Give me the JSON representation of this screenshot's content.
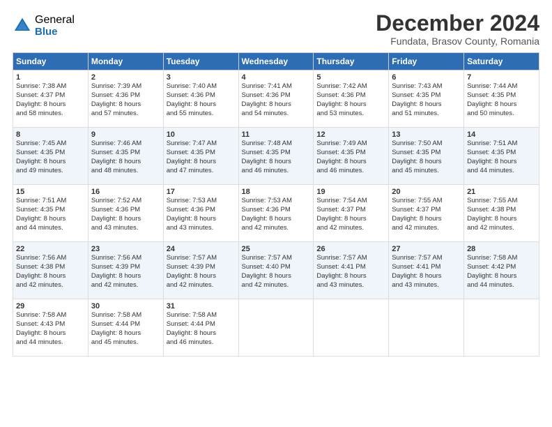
{
  "header": {
    "logo_general": "General",
    "logo_blue": "Blue",
    "title": "December 2024",
    "subtitle": "Fundata, Brasov County, Romania"
  },
  "columns": [
    "Sunday",
    "Monday",
    "Tuesday",
    "Wednesday",
    "Thursday",
    "Friday",
    "Saturday"
  ],
  "weeks": [
    [
      {
        "day": "1",
        "lines": [
          "Sunrise: 7:38 AM",
          "Sunset: 4:37 PM",
          "Daylight: 8 hours",
          "and 58 minutes."
        ]
      },
      {
        "day": "2",
        "lines": [
          "Sunrise: 7:39 AM",
          "Sunset: 4:36 PM",
          "Daylight: 8 hours",
          "and 57 minutes."
        ]
      },
      {
        "day": "3",
        "lines": [
          "Sunrise: 7:40 AM",
          "Sunset: 4:36 PM",
          "Daylight: 8 hours",
          "and 55 minutes."
        ]
      },
      {
        "day": "4",
        "lines": [
          "Sunrise: 7:41 AM",
          "Sunset: 4:36 PM",
          "Daylight: 8 hours",
          "and 54 minutes."
        ]
      },
      {
        "day": "5",
        "lines": [
          "Sunrise: 7:42 AM",
          "Sunset: 4:36 PM",
          "Daylight: 8 hours",
          "and 53 minutes."
        ]
      },
      {
        "day": "6",
        "lines": [
          "Sunrise: 7:43 AM",
          "Sunset: 4:35 PM",
          "Daylight: 8 hours",
          "and 51 minutes."
        ]
      },
      {
        "day": "7",
        "lines": [
          "Sunrise: 7:44 AM",
          "Sunset: 4:35 PM",
          "Daylight: 8 hours",
          "and 50 minutes."
        ]
      }
    ],
    [
      {
        "day": "8",
        "lines": [
          "Sunrise: 7:45 AM",
          "Sunset: 4:35 PM",
          "Daylight: 8 hours",
          "and 49 minutes."
        ]
      },
      {
        "day": "9",
        "lines": [
          "Sunrise: 7:46 AM",
          "Sunset: 4:35 PM",
          "Daylight: 8 hours",
          "and 48 minutes."
        ]
      },
      {
        "day": "10",
        "lines": [
          "Sunrise: 7:47 AM",
          "Sunset: 4:35 PM",
          "Daylight: 8 hours",
          "and 47 minutes."
        ]
      },
      {
        "day": "11",
        "lines": [
          "Sunrise: 7:48 AM",
          "Sunset: 4:35 PM",
          "Daylight: 8 hours",
          "and 46 minutes."
        ]
      },
      {
        "day": "12",
        "lines": [
          "Sunrise: 7:49 AM",
          "Sunset: 4:35 PM",
          "Daylight: 8 hours",
          "and 46 minutes."
        ]
      },
      {
        "day": "13",
        "lines": [
          "Sunrise: 7:50 AM",
          "Sunset: 4:35 PM",
          "Daylight: 8 hours",
          "and 45 minutes."
        ]
      },
      {
        "day": "14",
        "lines": [
          "Sunrise: 7:51 AM",
          "Sunset: 4:35 PM",
          "Daylight: 8 hours",
          "and 44 minutes."
        ]
      }
    ],
    [
      {
        "day": "15",
        "lines": [
          "Sunrise: 7:51 AM",
          "Sunset: 4:35 PM",
          "Daylight: 8 hours",
          "and 44 minutes."
        ]
      },
      {
        "day": "16",
        "lines": [
          "Sunrise: 7:52 AM",
          "Sunset: 4:36 PM",
          "Daylight: 8 hours",
          "and 43 minutes."
        ]
      },
      {
        "day": "17",
        "lines": [
          "Sunrise: 7:53 AM",
          "Sunset: 4:36 PM",
          "Daylight: 8 hours",
          "and 43 minutes."
        ]
      },
      {
        "day": "18",
        "lines": [
          "Sunrise: 7:53 AM",
          "Sunset: 4:36 PM",
          "Daylight: 8 hours",
          "and 42 minutes."
        ]
      },
      {
        "day": "19",
        "lines": [
          "Sunrise: 7:54 AM",
          "Sunset: 4:37 PM",
          "Daylight: 8 hours",
          "and 42 minutes."
        ]
      },
      {
        "day": "20",
        "lines": [
          "Sunrise: 7:55 AM",
          "Sunset: 4:37 PM",
          "Daylight: 8 hours",
          "and 42 minutes."
        ]
      },
      {
        "day": "21",
        "lines": [
          "Sunrise: 7:55 AM",
          "Sunset: 4:38 PM",
          "Daylight: 8 hours",
          "and 42 minutes."
        ]
      }
    ],
    [
      {
        "day": "22",
        "lines": [
          "Sunrise: 7:56 AM",
          "Sunset: 4:38 PM",
          "Daylight: 8 hours",
          "and 42 minutes."
        ]
      },
      {
        "day": "23",
        "lines": [
          "Sunrise: 7:56 AM",
          "Sunset: 4:39 PM",
          "Daylight: 8 hours",
          "and 42 minutes."
        ]
      },
      {
        "day": "24",
        "lines": [
          "Sunrise: 7:57 AM",
          "Sunset: 4:39 PM",
          "Daylight: 8 hours",
          "and 42 minutes."
        ]
      },
      {
        "day": "25",
        "lines": [
          "Sunrise: 7:57 AM",
          "Sunset: 4:40 PM",
          "Daylight: 8 hours",
          "and 42 minutes."
        ]
      },
      {
        "day": "26",
        "lines": [
          "Sunrise: 7:57 AM",
          "Sunset: 4:41 PM",
          "Daylight: 8 hours",
          "and 43 minutes."
        ]
      },
      {
        "day": "27",
        "lines": [
          "Sunrise: 7:57 AM",
          "Sunset: 4:41 PM",
          "Daylight: 8 hours",
          "and 43 minutes."
        ]
      },
      {
        "day": "28",
        "lines": [
          "Sunrise: 7:58 AM",
          "Sunset: 4:42 PM",
          "Daylight: 8 hours",
          "and 44 minutes."
        ]
      }
    ],
    [
      {
        "day": "29",
        "lines": [
          "Sunrise: 7:58 AM",
          "Sunset: 4:43 PM",
          "Daylight: 8 hours",
          "and 44 minutes."
        ]
      },
      {
        "day": "30",
        "lines": [
          "Sunrise: 7:58 AM",
          "Sunset: 4:44 PM",
          "Daylight: 8 hours",
          "and 45 minutes."
        ]
      },
      {
        "day": "31",
        "lines": [
          "Sunrise: 7:58 AM",
          "Sunset: 4:44 PM",
          "Daylight: 8 hours",
          "and 46 minutes."
        ]
      },
      {
        "day": "",
        "lines": []
      },
      {
        "day": "",
        "lines": []
      },
      {
        "day": "",
        "lines": []
      },
      {
        "day": "",
        "lines": []
      }
    ]
  ]
}
